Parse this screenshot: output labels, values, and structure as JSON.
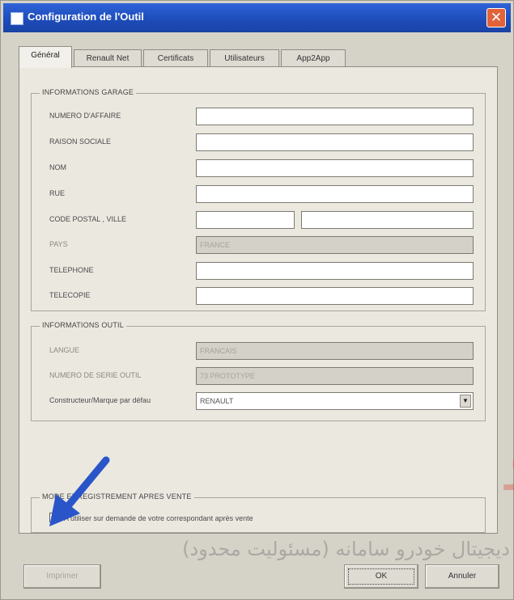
{
  "window": {
    "title": "Configuration de l'Outil",
    "close_glyph": "✕"
  },
  "tabs": [
    {
      "label": "Général",
      "active": true
    },
    {
      "label": "Renault Net",
      "active": false
    },
    {
      "label": "Certificats",
      "active": false
    },
    {
      "label": "Utilisateurs",
      "active": false
    },
    {
      "label": "App2App",
      "active": false
    }
  ],
  "garage": {
    "title": "INFORMATIONS GARAGE",
    "numero_affaire": {
      "label": "NUMERO D'AFFAIRE",
      "value": ""
    },
    "raison_sociale": {
      "label": "RAISON SOCIALE",
      "value": ""
    },
    "nom": {
      "label": "NOM",
      "value": ""
    },
    "rue": {
      "label": "RUE",
      "value": ""
    },
    "code_postal_ville": {
      "label": "CODE POSTAL , VILLE",
      "postal_value": "",
      "ville_value": ""
    },
    "pays": {
      "label": "PAYS",
      "value": "FRANCE"
    },
    "telephone": {
      "label": "TELEPHONE",
      "value": ""
    },
    "telecopie": {
      "label": "TELECOPIE",
      "value": ""
    }
  },
  "outil": {
    "title": "INFORMATIONS OUTIL",
    "langue": {
      "label": "LANGUE",
      "value": "FRANCAIS"
    },
    "numero_serie": {
      "label": "NUMERO DE SERIE OUTIL",
      "value": "73 PROTOTYPE"
    },
    "constructeur": {
      "label": "Constructeur/Marque par défau",
      "value": "RENAULT",
      "arrow_glyph": "▼"
    }
  },
  "enregistrement": {
    "title": "MODE ENREGISTREMENT APRES VENTE",
    "checkbox_label": "A utiliser sur demande de votre correspondant après vente",
    "checked": true,
    "check_glyph": "✓"
  },
  "buttons": {
    "imprimer": "Imprimer",
    "ok": "OK",
    "annuler": "Annuler"
  },
  "watermark": {
    "logo_text": "جیتال خودرو",
    "caption": "دیجیتال خودرو سامانه (مسئولیت محدود)"
  },
  "colors": {
    "title_bar": "#2e63d8",
    "close_button": "#e2623a",
    "watermark_red": "#d9432f",
    "arrow_blue": "#2a55c9"
  }
}
